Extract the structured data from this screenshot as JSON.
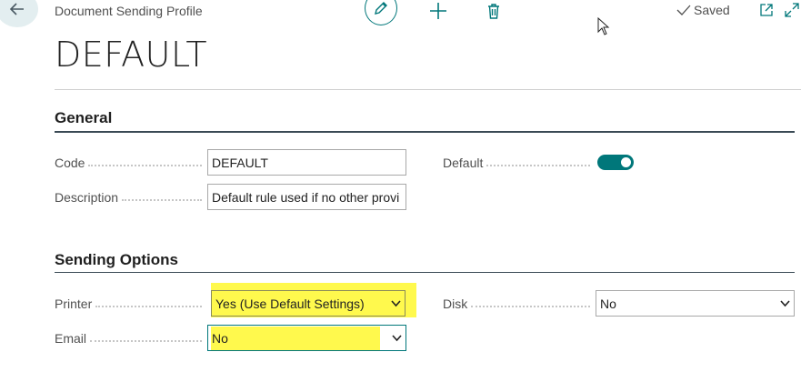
{
  "header": {
    "breadcrumb": "Document Sending Profile",
    "saved_label": "Saved",
    "title": "DEFAULT"
  },
  "general": {
    "section_title": "General",
    "code_label": "Code",
    "code_value": "DEFAULT",
    "description_label": "Description",
    "description_value": "Default rule used if no other provi",
    "default_label": "Default",
    "default_on": true
  },
  "sending_options": {
    "section_title": "Sending Options",
    "printer_label": "Printer",
    "printer_value": "Yes (Use Default Settings)",
    "email_label": "Email",
    "email_value": "No",
    "disk_label": "Disk",
    "disk_value": "No"
  },
  "colors": {
    "accent": "#00777a",
    "highlight": "#fff94d"
  }
}
